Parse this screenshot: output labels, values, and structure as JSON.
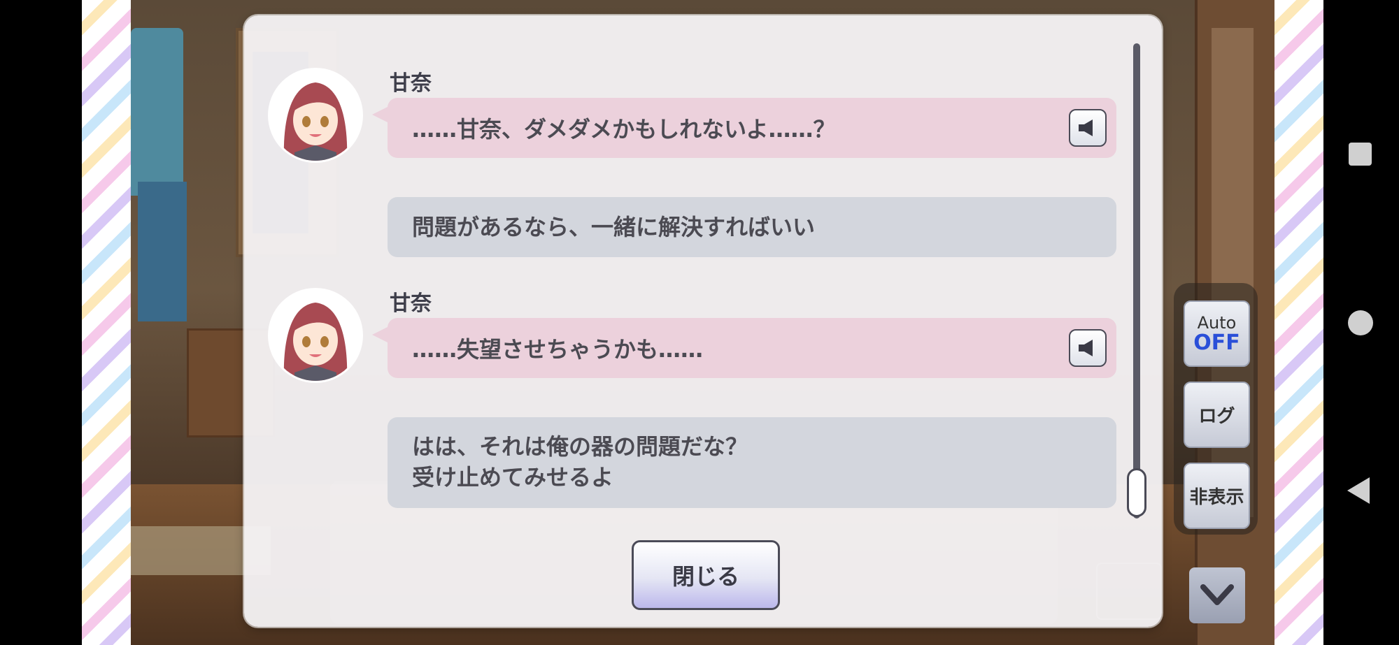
{
  "log": {
    "entries": [
      {
        "speaker": "甘奈",
        "text": "……甘奈、ダメダメかもしれないよ……？",
        "has_voice": true
      },
      {
        "text": "問題があるなら、一緒に解決すればいい"
      },
      {
        "speaker": "甘奈",
        "text": "……失望させちゃうかも……",
        "has_voice": true
      },
      {
        "line1": "はは、それは俺の器の問題だな？",
        "line2": "受け止めてみせるよ"
      }
    ],
    "close_label": "閉じる"
  },
  "controls": {
    "auto_top": "Auto",
    "auto_bottom": "OFF",
    "log_label": "ログ",
    "hide_label": "非表示"
  },
  "colors": {
    "speaker_bubble": "#ecd1dc",
    "player_bubble": "#d3d6dd",
    "auto_off": "#2a4fd8"
  },
  "icons": [
    "speaker-icon",
    "chevron-down-icon",
    "square-icon",
    "circle-icon",
    "back-icon"
  ]
}
